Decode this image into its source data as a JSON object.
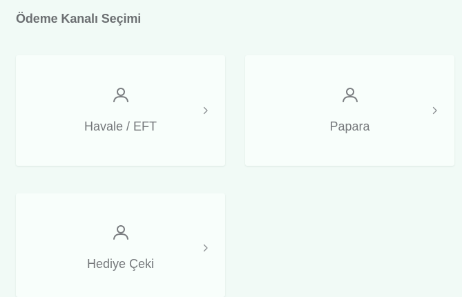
{
  "page": {
    "title": "Ödeme Kanalı Seçimi"
  },
  "payment_channels": [
    {
      "label": "Havale / EFT",
      "icon": "user-icon"
    },
    {
      "label": "Papara",
      "icon": "user-icon"
    },
    {
      "label": "Hediye Çeki",
      "icon": "user-icon"
    }
  ],
  "colors": {
    "background": "#f1faf6",
    "card": "#f8fefb",
    "text": "#75787b",
    "title": "#6c6f72",
    "icon": "#7a7d80"
  }
}
